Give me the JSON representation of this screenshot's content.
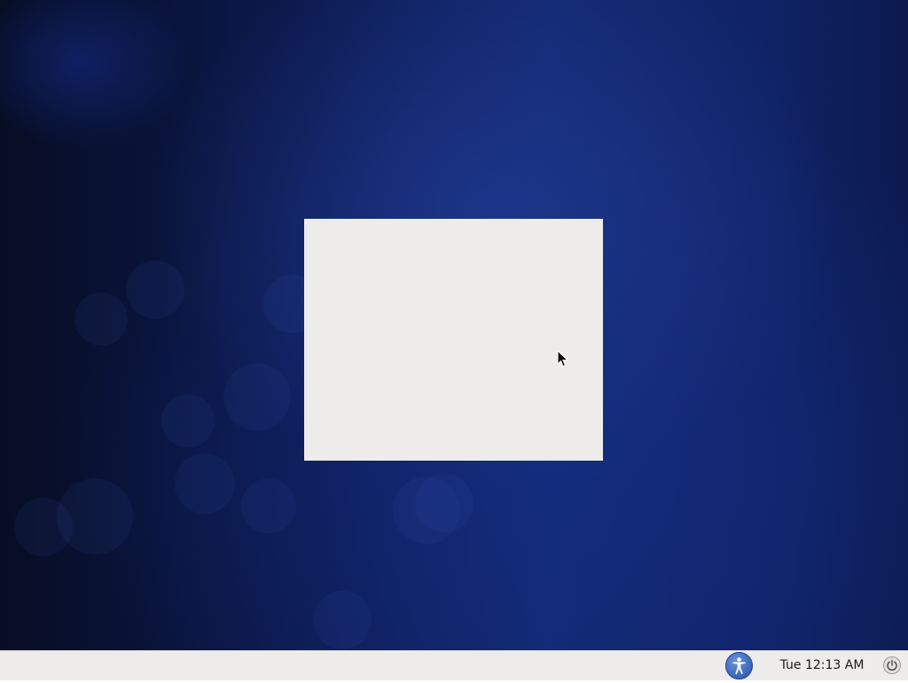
{
  "panel": {
    "clock_text": "Tue 12:13 AM",
    "accessibility_icon": "universal-access-icon",
    "power_icon": "power-icon"
  },
  "colors": {
    "panel_bg": "#edeceb",
    "desktop_bg": "#122a72",
    "dialog_bg": "#edeceb",
    "accessibility_blue": "#3d69bd"
  }
}
